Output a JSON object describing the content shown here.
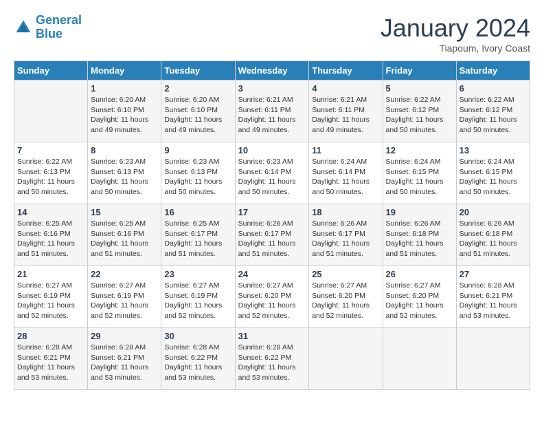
{
  "header": {
    "logo_line1": "General",
    "logo_line2": "Blue",
    "month": "January 2024",
    "location": "Tiapoum, Ivory Coast"
  },
  "weekdays": [
    "Sunday",
    "Monday",
    "Tuesday",
    "Wednesday",
    "Thursday",
    "Friday",
    "Saturday"
  ],
  "weeks": [
    [
      {
        "day": "",
        "info": ""
      },
      {
        "day": "1",
        "info": "Sunrise: 6:20 AM\nSunset: 6:10 PM\nDaylight: 11 hours and 49 minutes."
      },
      {
        "day": "2",
        "info": "Sunrise: 6:20 AM\nSunset: 6:10 PM\nDaylight: 11 hours and 49 minutes."
      },
      {
        "day": "3",
        "info": "Sunrise: 6:21 AM\nSunset: 6:11 PM\nDaylight: 11 hours and 49 minutes."
      },
      {
        "day": "4",
        "info": "Sunrise: 6:21 AM\nSunset: 6:11 PM\nDaylight: 11 hours and 49 minutes."
      },
      {
        "day": "5",
        "info": "Sunrise: 6:22 AM\nSunset: 6:12 PM\nDaylight: 11 hours and 50 minutes."
      },
      {
        "day": "6",
        "info": "Sunrise: 6:22 AM\nSunset: 6:12 PM\nDaylight: 11 hours and 50 minutes."
      }
    ],
    [
      {
        "day": "7",
        "info": "Sunrise: 6:22 AM\nSunset: 6:13 PM\nDaylight: 11 hours and 50 minutes."
      },
      {
        "day": "8",
        "info": "Sunrise: 6:23 AM\nSunset: 6:13 PM\nDaylight: 11 hours and 50 minutes."
      },
      {
        "day": "9",
        "info": "Sunrise: 6:23 AM\nSunset: 6:13 PM\nDaylight: 11 hours and 50 minutes."
      },
      {
        "day": "10",
        "info": "Sunrise: 6:23 AM\nSunset: 6:14 PM\nDaylight: 11 hours and 50 minutes."
      },
      {
        "day": "11",
        "info": "Sunrise: 6:24 AM\nSunset: 6:14 PM\nDaylight: 11 hours and 50 minutes."
      },
      {
        "day": "12",
        "info": "Sunrise: 6:24 AM\nSunset: 6:15 PM\nDaylight: 11 hours and 50 minutes."
      },
      {
        "day": "13",
        "info": "Sunrise: 6:24 AM\nSunset: 6:15 PM\nDaylight: 11 hours and 50 minutes."
      }
    ],
    [
      {
        "day": "14",
        "info": "Sunrise: 6:25 AM\nSunset: 6:16 PM\nDaylight: 11 hours and 51 minutes."
      },
      {
        "day": "15",
        "info": "Sunrise: 6:25 AM\nSunset: 6:16 PM\nDaylight: 11 hours and 51 minutes."
      },
      {
        "day": "16",
        "info": "Sunrise: 6:25 AM\nSunset: 6:17 PM\nDaylight: 11 hours and 51 minutes."
      },
      {
        "day": "17",
        "info": "Sunrise: 6:26 AM\nSunset: 6:17 PM\nDaylight: 11 hours and 51 minutes."
      },
      {
        "day": "18",
        "info": "Sunrise: 6:26 AM\nSunset: 6:17 PM\nDaylight: 11 hours and 51 minutes."
      },
      {
        "day": "19",
        "info": "Sunrise: 6:26 AM\nSunset: 6:18 PM\nDaylight: 11 hours and 51 minutes."
      },
      {
        "day": "20",
        "info": "Sunrise: 6:26 AM\nSunset: 6:18 PM\nDaylight: 11 hours and 51 minutes."
      }
    ],
    [
      {
        "day": "21",
        "info": "Sunrise: 6:27 AM\nSunset: 6:19 PM\nDaylight: 11 hours and 52 minutes."
      },
      {
        "day": "22",
        "info": "Sunrise: 6:27 AM\nSunset: 6:19 PM\nDaylight: 11 hours and 52 minutes."
      },
      {
        "day": "23",
        "info": "Sunrise: 6:27 AM\nSunset: 6:19 PM\nDaylight: 11 hours and 52 minutes."
      },
      {
        "day": "24",
        "info": "Sunrise: 6:27 AM\nSunset: 6:20 PM\nDaylight: 11 hours and 52 minutes."
      },
      {
        "day": "25",
        "info": "Sunrise: 6:27 AM\nSunset: 6:20 PM\nDaylight: 11 hours and 52 minutes."
      },
      {
        "day": "26",
        "info": "Sunrise: 6:27 AM\nSunset: 6:20 PM\nDaylight: 11 hours and 52 minutes."
      },
      {
        "day": "27",
        "info": "Sunrise: 6:28 AM\nSunset: 6:21 PM\nDaylight: 11 hours and 53 minutes."
      }
    ],
    [
      {
        "day": "28",
        "info": "Sunrise: 6:28 AM\nSunset: 6:21 PM\nDaylight: 11 hours and 53 minutes."
      },
      {
        "day": "29",
        "info": "Sunrise: 6:28 AM\nSunset: 6:21 PM\nDaylight: 11 hours and 53 minutes."
      },
      {
        "day": "30",
        "info": "Sunrise: 6:28 AM\nSunset: 6:22 PM\nDaylight: 11 hours and 53 minutes."
      },
      {
        "day": "31",
        "info": "Sunrise: 6:28 AM\nSunset: 6:22 PM\nDaylight: 11 hours and 53 minutes."
      },
      {
        "day": "",
        "info": ""
      },
      {
        "day": "",
        "info": ""
      },
      {
        "day": "",
        "info": ""
      }
    ]
  ]
}
